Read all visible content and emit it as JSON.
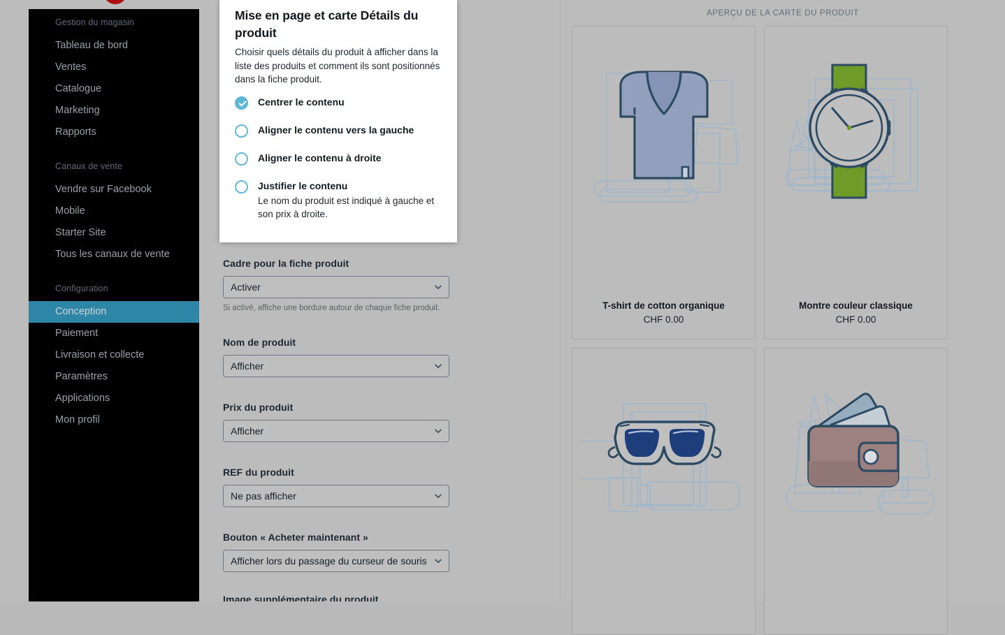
{
  "sidebar": {
    "sections": [
      {
        "label": "Gestion du magasin",
        "items": [
          {
            "label": "Tableau de bord",
            "active": false
          },
          {
            "label": "Ventes",
            "active": false
          },
          {
            "label": "Catalogue",
            "active": false
          },
          {
            "label": "Marketing",
            "active": false
          },
          {
            "label": "Rapports",
            "active": false
          }
        ]
      },
      {
        "label": "Canaux de vente",
        "items": [
          {
            "label": "Vendre sur Facebook",
            "active": false
          },
          {
            "label": "Mobile",
            "active": false
          },
          {
            "label": "Starter Site",
            "active": false
          },
          {
            "label": "Tous les canaux de vente",
            "active": false
          }
        ]
      },
      {
        "label": "Configuration",
        "items": [
          {
            "label": "Conception",
            "active": true
          },
          {
            "label": "Paiement",
            "active": false
          },
          {
            "label": "Livraison et collecte",
            "active": false
          },
          {
            "label": "Paramètres",
            "active": false
          },
          {
            "label": "Applications",
            "active": false
          },
          {
            "label": "Mon profil",
            "active": false
          }
        ]
      }
    ],
    "active_color": "#2e86a6"
  },
  "popover": {
    "title": "Mise en page et carte Détails du produit",
    "description": "Choisir quels détails du produit à afficher dans la liste des produits et comment ils sont positionnés dans la fiche produit.",
    "options": [
      {
        "label": "Centrer le contenu",
        "selected": true,
        "sub": ""
      },
      {
        "label": "Aligner le contenu vers la gauche",
        "selected": false,
        "sub": ""
      },
      {
        "label": "Aligner le contenu à droite",
        "selected": false,
        "sub": ""
      },
      {
        "label": "Justifier le contenu",
        "selected": false,
        "sub": "Le nom du produit est indiqué à gauche et son prix à droite."
      }
    ],
    "accent_color": "#5cb6d6"
  },
  "form": {
    "fields": [
      {
        "label": "Cadre pour la fiche produit",
        "value": "Activer",
        "help": "Si activé, affiche une bordure autour de chaque fiche produit."
      },
      {
        "label": "Nom de produit",
        "value": "Afficher",
        "help": ""
      },
      {
        "label": "Prix du produit",
        "value": "Afficher",
        "help": ""
      },
      {
        "label": "REF du produit",
        "value": "Ne pas afficher",
        "help": ""
      },
      {
        "label": "Bouton « Acheter maintenant »",
        "value": "Afficher lors du passage du curseur de souris",
        "help": ""
      }
    ],
    "cutoff_label": "Image supplémentaire du produit"
  },
  "preview": {
    "heading": "APERÇU DE LA CARTE DU PRODUIT",
    "cards": [
      {
        "name": "T-shirt de cotton organique",
        "price": "CHF 0.00",
        "icon": "tshirt-icon"
      },
      {
        "name": "Montre couleur classique",
        "price": "CHF 0.00",
        "icon": "watch-icon"
      },
      {
        "name": "",
        "price": "",
        "icon": "sunglasses-icon"
      },
      {
        "name": "",
        "price": "",
        "icon": "wallet-icon"
      }
    ]
  }
}
